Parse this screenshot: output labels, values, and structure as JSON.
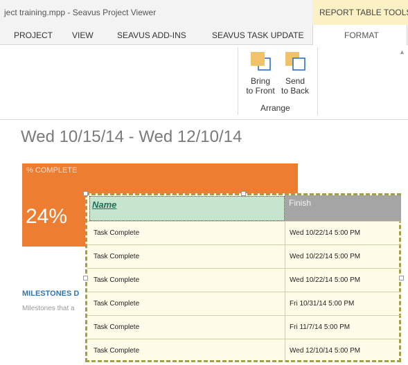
{
  "window": {
    "title": "ject training.mpp - Seavus Project Viewer",
    "context_tab_group": "REPORT TABLE TOOLS"
  },
  "tabs": [
    {
      "label": "PROJECT"
    },
    {
      "label": "VIEW"
    },
    {
      "label": "SEAVUS ADD-INS"
    },
    {
      "label": "SEAVUS TASK UPDATE"
    },
    {
      "label": "FORMAT",
      "active": true
    }
  ],
  "ribbon": {
    "arrange_group": {
      "label": "Arrange",
      "bring_to_front": {
        "line1": "Bring",
        "line2": "to Front",
        "icon": "bring-to-front-icon"
      },
      "send_to_back": {
        "line1": "Send",
        "line2": "to Back",
        "icon": "send-to-back-icon"
      }
    }
  },
  "report": {
    "date_range": "Wed 10/15/14 - Wed 12/10/14",
    "percent_complete": {
      "label": "% COMPLETE",
      "value": "24%"
    },
    "milestones": {
      "title": "MILESTONES D",
      "description": "Milestones that a"
    },
    "table": {
      "columns": {
        "name": "Name",
        "finish": "Finish"
      },
      "rows": [
        {
          "name": "Task Complete",
          "finish": "Wed 10/22/14 5:00 PM"
        },
        {
          "name": "Task Complete",
          "finish": "Wed 10/22/14 5:00 PM"
        },
        {
          "name": "Task Complete",
          "finish": "Wed 10/22/14 5:00 PM"
        },
        {
          "name": "Task Complete",
          "finish": "Fri 10/31/14 5:00 PM"
        },
        {
          "name": "Task Complete",
          "finish": "Fri 11/7/14 5:00 PM"
        },
        {
          "name": "Task Complete",
          "finish": "Wed 12/10/14 5:00 PM"
        }
      ]
    }
  },
  "colors": {
    "accent_orange": "#ed7d31",
    "context_tab": "#fbf1c4",
    "table_selection": "#a0a04a",
    "header_name_fill": "#c5e5cf",
    "header_finish_fill": "#a5a5a5"
  }
}
